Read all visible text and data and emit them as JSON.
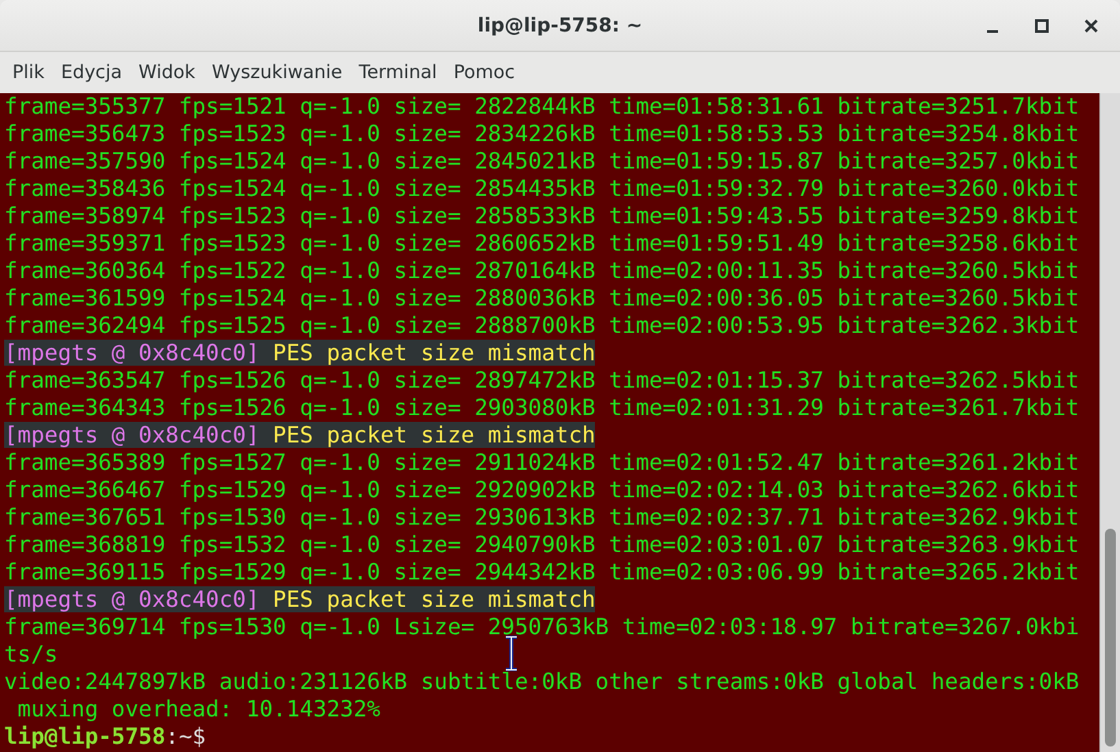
{
  "window": {
    "title": "lip@lip-5758: ~"
  },
  "menu": [
    "Plik",
    "Edycja",
    "Widok",
    "Wyszukiwanie",
    "Terminal",
    "Pomoc"
  ],
  "terminal": {
    "lines": [
      {
        "kind": "output",
        "text": "frame=355377 fps=1521 q=-1.0 size= 2822844kB time=01:58:31.61 bitrate=3251.7kbit"
      },
      {
        "kind": "output",
        "text": "frame=356473 fps=1523 q=-1.0 size= 2834226kB time=01:58:53.53 bitrate=3254.8kbit"
      },
      {
        "kind": "output",
        "text": "frame=357590 fps=1524 q=-1.0 size= 2845021kB time=01:59:15.87 bitrate=3257.0kbit"
      },
      {
        "kind": "output",
        "text": "frame=358436 fps=1524 q=-1.0 size= 2854435kB time=01:59:32.79 bitrate=3260.0kbit"
      },
      {
        "kind": "output",
        "text": "frame=358974 fps=1523 q=-1.0 size= 2858533kB time=01:59:43.55 bitrate=3259.8kbit"
      },
      {
        "kind": "output",
        "text": "frame=359371 fps=1523 q=-1.0 size= 2860652kB time=01:59:51.49 bitrate=3258.6kbit"
      },
      {
        "kind": "output",
        "text": "frame=360364 fps=1522 q=-1.0 size= 2870164kB time=02:00:11.35 bitrate=3260.5kbit"
      },
      {
        "kind": "output",
        "text": "frame=361599 fps=1524 q=-1.0 size= 2880036kB time=02:00:36.05 bitrate=3260.5kbit"
      },
      {
        "kind": "output",
        "text": "frame=362494 fps=1525 q=-1.0 size= 2888700kB time=02:00:53.95 bitrate=3262.3kbit"
      },
      {
        "kind": "warning",
        "tag": "[mpegts @ 0x8c40c0]",
        "text": " PES packet size mismatch"
      },
      {
        "kind": "output",
        "text": "frame=363547 fps=1526 q=-1.0 size= 2897472kB time=02:01:15.37 bitrate=3262.5kbit"
      },
      {
        "kind": "output",
        "text": "frame=364343 fps=1526 q=-1.0 size= 2903080kB time=02:01:31.29 bitrate=3261.7kbit"
      },
      {
        "kind": "warning",
        "tag": "[mpegts @ 0x8c40c0]",
        "text": " PES packet size mismatch"
      },
      {
        "kind": "output",
        "text": "frame=365389 fps=1527 q=-1.0 size= 2911024kB time=02:01:52.47 bitrate=3261.2kbit"
      },
      {
        "kind": "output",
        "text": "frame=366467 fps=1529 q=-1.0 size= 2920902kB time=02:02:14.03 bitrate=3262.6kbit"
      },
      {
        "kind": "output",
        "text": "frame=367651 fps=1530 q=-1.0 size= 2930613kB time=02:02:37.71 bitrate=3262.9kbit"
      },
      {
        "kind": "output",
        "text": "frame=368819 fps=1532 q=-1.0 size= 2940790kB time=02:03:01.07 bitrate=3263.9kbit"
      },
      {
        "kind": "output",
        "text": "frame=369115 fps=1529 q=-1.0 size= 2944342kB time=02:03:06.99 bitrate=3265.2kbit"
      },
      {
        "kind": "warning",
        "tag": "[mpegts @ 0x8c40c0]",
        "text": " PES packet size mismatch"
      },
      {
        "kind": "output",
        "text": "frame=369714 fps=1530 q=-1.0 Lsize= 2950763kB time=02:03:18.97 bitrate=3267.0kbi"
      },
      {
        "kind": "output",
        "text": "ts/s"
      },
      {
        "kind": "output",
        "text": "video:2447897kB audio:231126kB subtitle:0kB other streams:0kB global headers:0kB"
      },
      {
        "kind": "output",
        "text": " muxing overhead: 10.143232%"
      },
      {
        "kind": "prompt",
        "user_host": "lip@lip-5758",
        "text": ":~$"
      }
    ]
  }
}
